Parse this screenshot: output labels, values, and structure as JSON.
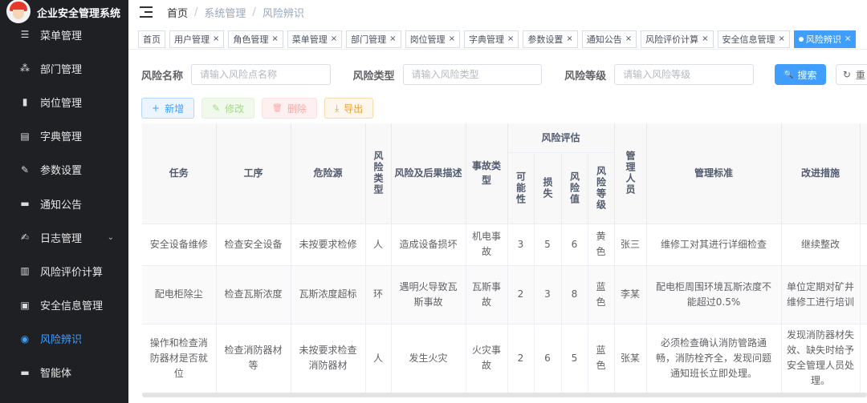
{
  "app": {
    "title": "企业安全管理系统"
  },
  "sidebar": {
    "items": [
      {
        "label": "菜单管理",
        "icon": "menu-icon",
        "glyph": "☰",
        "active": false,
        "expand": false
      },
      {
        "label": "部门管理",
        "icon": "tree-icon",
        "glyph": "⁂",
        "active": false,
        "expand": false
      },
      {
        "label": "岗位管理",
        "icon": "post-icon",
        "glyph": "▮",
        "active": false,
        "expand": false
      },
      {
        "label": "字典管理",
        "icon": "dict-icon",
        "glyph": "▤",
        "active": false,
        "expand": false
      },
      {
        "label": "参数设置",
        "icon": "edit-icon",
        "glyph": "✎",
        "active": false,
        "expand": false
      },
      {
        "label": "通知公告",
        "icon": "message-icon",
        "glyph": "▬",
        "active": false,
        "expand": false
      },
      {
        "label": "日志管理",
        "icon": "log-icon",
        "glyph": "✍",
        "active": false,
        "expand": true
      },
      {
        "label": "风险评价计算",
        "icon": "chart-icon",
        "glyph": "▥",
        "active": false,
        "expand": false
      },
      {
        "label": "安全信息管理",
        "icon": "document-icon",
        "glyph": "▣",
        "active": false,
        "expand": false
      },
      {
        "label": "风险辨识",
        "icon": "eye-icon",
        "glyph": "◉",
        "active": true,
        "expand": false
      },
      {
        "label": "智能体",
        "icon": "chat-icon",
        "glyph": "▬",
        "active": false,
        "expand": false
      }
    ],
    "expand_glyph": "⌄"
  },
  "breadcrumb": {
    "home": "首页",
    "sep": "/",
    "parent": "系统管理",
    "current": "风险辨识"
  },
  "tags": [
    {
      "label": "首页",
      "closable": false,
      "active": false
    },
    {
      "label": "用户管理",
      "closable": true,
      "active": false
    },
    {
      "label": "角色管理",
      "closable": true,
      "active": false
    },
    {
      "label": "菜单管理",
      "closable": true,
      "active": false
    },
    {
      "label": "部门管理",
      "closable": true,
      "active": false
    },
    {
      "label": "岗位管理",
      "closable": true,
      "active": false
    },
    {
      "label": "字典管理",
      "closable": true,
      "active": false
    },
    {
      "label": "参数设置",
      "closable": true,
      "active": false
    },
    {
      "label": "通知公告",
      "closable": true,
      "active": false
    },
    {
      "label": "风险评价计算",
      "closable": true,
      "active": false
    },
    {
      "label": "安全信息管理",
      "closable": true,
      "active": false
    },
    {
      "label": "风险辨识",
      "closable": true,
      "active": true
    }
  ],
  "tag_close_glyph": "×",
  "search": {
    "fields": [
      {
        "label": "风险名称",
        "placeholder": "请输入风险点名称"
      },
      {
        "label": "风险类型",
        "placeholder": "请输入风险类型"
      },
      {
        "label": "风险等级",
        "placeholder": "请输入风险等级"
      }
    ],
    "search_label": "搜索",
    "search_glyph": "🔍",
    "reset_label": "重",
    "reset_glyph": "↻"
  },
  "toolbar": {
    "add": {
      "label": "新增",
      "glyph": "+"
    },
    "edit": {
      "label": "修改",
      "glyph": "✎"
    },
    "delete": {
      "label": "删除",
      "glyph": "🗑"
    },
    "export": {
      "label": "导出",
      "glyph": "⤓"
    }
  },
  "table": {
    "group_header": "风险评估",
    "headers": {
      "task": "任务",
      "process": "工序",
      "hazard": "危险源",
      "risk_type": "风险类型",
      "description": "风险及后果描述",
      "accident_type": "事故类型",
      "possibility": "可能性",
      "loss": "损失",
      "risk_value": "风险值",
      "risk_level": "风险等级",
      "manager": "管理人员",
      "standard": "管理标准",
      "improvement": "改进措施"
    },
    "rows": [
      {
        "task": "安全设备维修",
        "process": "检查安全设备",
        "hazard": "未按要求检修",
        "risk_type": "人",
        "description": "造成设备损坏",
        "accident_type": "机电事故",
        "possibility": "3",
        "loss": "5",
        "risk_value": "6",
        "risk_level": "黄色",
        "manager": "张三",
        "standard": "维修工对其进行详细检查",
        "improvement": "继续整改"
      },
      {
        "task": "配电柜除尘",
        "process": "检查瓦斯浓度",
        "hazard": "瓦斯浓度超标",
        "risk_type": "环",
        "description": "遇明火导致瓦斯事故",
        "accident_type": "瓦斯事故",
        "possibility": "2",
        "loss": "3",
        "risk_value": "8",
        "risk_level": "蓝色",
        "manager": "李某",
        "standard": "配电柜周围环境瓦斯浓度不能超过0.5%",
        "improvement": "单位定期对矿井维修工进行培训"
      },
      {
        "task": "操作和检查消防器材是否就位",
        "process": "检查消防器材等",
        "hazard": "未按要求检查消防器材",
        "risk_type": "人",
        "description": "发生火灾",
        "accident_type": "火灾事故",
        "possibility": "2",
        "loss": "6",
        "risk_value": "5",
        "risk_level": "蓝色",
        "manager": "张某",
        "standard": "必须检查确认消防管路通畅，消防栓齐全，发现问题通知班长立即处理。",
        "improvement": "发现消防器材失效、缺失时给予安全管理人员处理。"
      }
    ]
  }
}
